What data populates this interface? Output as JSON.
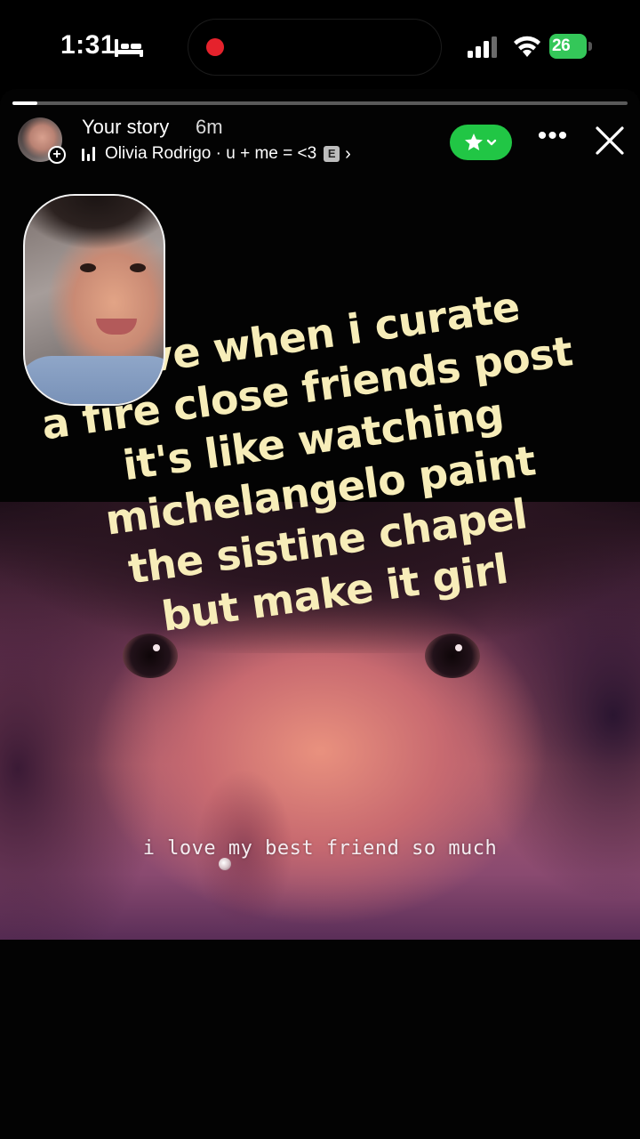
{
  "status_bar": {
    "time": "1:31",
    "battery": "26"
  },
  "story": {
    "progress": 0.04,
    "title": "Your story",
    "time_ago": "6m",
    "music": {
      "artist": "Olivia Rodrigo",
      "separator": " · ",
      "song": "u + me = <3",
      "explicit": "E",
      "chevron": "›"
    },
    "close_friends_color": "#21c645",
    "more_label": "•••"
  },
  "overlay": {
    "lines": [
      "i love when i curate",
      "a fire close friends post",
      "it's like watching",
      "michelangelo paint",
      "the sistine chapel",
      "but make it girl"
    ],
    "color": "#f7edb9"
  },
  "photo_caption": "i love my best friend so much",
  "icons": {
    "sleep": "bed-icon",
    "record": "recording-indicator-icon",
    "signal": "cellular-signal-icon",
    "wifi": "wifi-icon",
    "battery": "battery-charging-icon",
    "music": "music-bars-icon",
    "star": "star-icon",
    "more": "more-horizontal-icon",
    "close": "close-icon"
  }
}
